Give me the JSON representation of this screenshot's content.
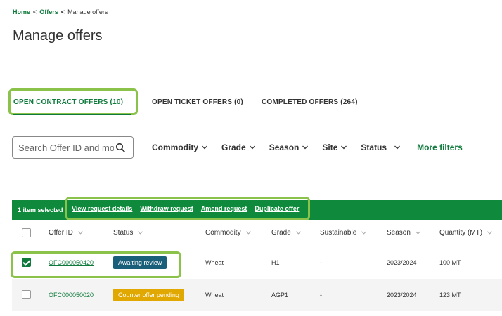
{
  "breadcrumb": {
    "home": "Home",
    "offers": "Offers",
    "current": "Manage offers",
    "sep": "<"
  },
  "page": {
    "title": "Manage offers"
  },
  "tabs": [
    {
      "label": "OPEN CONTRACT OFFERS (10)"
    },
    {
      "label": "OPEN TICKET OFFERS (0)"
    },
    {
      "label": "COMPLETED OFFERS (264)"
    }
  ],
  "search": {
    "placeholder": "Search Offer ID and more"
  },
  "filters": [
    {
      "label": "Commodity"
    },
    {
      "label": "Grade"
    },
    {
      "label": "Season"
    },
    {
      "label": "Site"
    },
    {
      "label": "Status"
    }
  ],
  "more_filters": "More filters",
  "action_bar": {
    "selected": "1 item selected",
    "actions": [
      "View request details",
      "Withdraw request",
      "Amend request",
      "Duplicate offer"
    ]
  },
  "table": {
    "columns": [
      "Offer ID",
      "Status",
      "Commodity",
      "Grade",
      "Sustainable",
      "Season",
      "Quantity (MT)"
    ],
    "rows": [
      {
        "offer_id": "OFC000050420",
        "status": "Awaiting review",
        "commodity": "Wheat",
        "grade": "H1",
        "sustainable": "-",
        "season": "2023/2024",
        "quantity": "100 MT",
        "checked": true
      },
      {
        "offer_id": "OFC000050020",
        "status": "Counter offer pending",
        "commodity": "Wheat",
        "grade": "AGP1",
        "sustainable": "-",
        "season": "2023/2024",
        "quantity": "123 MT",
        "checked": false
      }
    ]
  },
  "colors": {
    "brand_green": "#0f7a3c",
    "action_bar": "#0f8a3c",
    "highlight": "#8bc34a",
    "badge_review": "#1a5f7a",
    "badge_counter": "#e0a800"
  },
  "icons": [
    "search-icon",
    "chevron-down-icon",
    "checkbox-icon"
  ]
}
